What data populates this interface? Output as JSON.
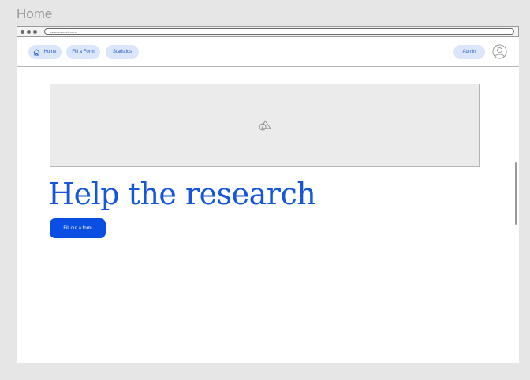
{
  "frame": {
    "title": "Home"
  },
  "browser": {
    "url": "www.research.com"
  },
  "nav": {
    "home_label": "Home",
    "fill_form_label": "Fill a Form",
    "statistics_label": "Statistics",
    "admin_label": "Admin"
  },
  "hero": {
    "image_icon": "image-placeholder-icon"
  },
  "main": {
    "headline": "Help the research",
    "cta_label": "Fill out a form"
  },
  "colors": {
    "accent": "#0a4ee3",
    "headline": "#1556da",
    "pill_bg": "#dbe6fb",
    "pill_text": "#2457c5"
  }
}
